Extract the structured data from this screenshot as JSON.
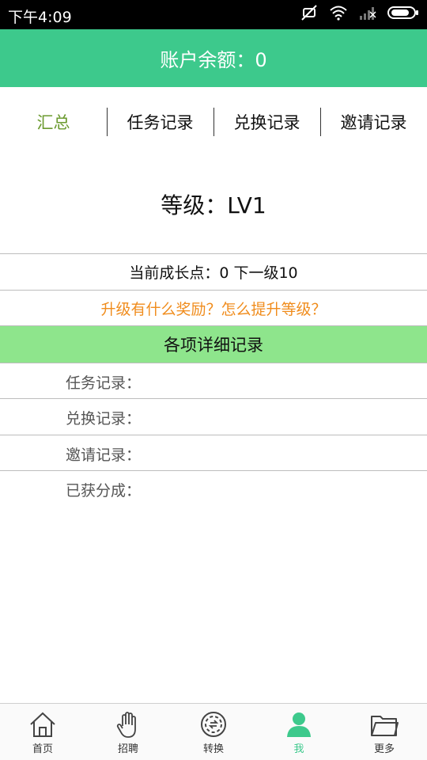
{
  "status_bar": {
    "time": "下午4:09"
  },
  "header": {
    "title": "账户余额：0"
  },
  "tabs": [
    {
      "label": "汇总",
      "active": true
    },
    {
      "label": "任务记录",
      "active": false
    },
    {
      "label": "兑换记录",
      "active": false
    },
    {
      "label": "邀请记录",
      "active": false
    }
  ],
  "summary": {
    "level_text": "等级：LV1",
    "growth_text": "当前成长点：0  下一级10",
    "reward_link": "升级有什么奖励？怎么提升等级？",
    "section_title": "各项详细记录",
    "details": [
      {
        "label": "任务记录："
      },
      {
        "label": "兑换记录："
      },
      {
        "label": "邀请记录："
      },
      {
        "label": "已获分成："
      }
    ]
  },
  "bottom_nav": [
    {
      "label": "首页",
      "icon": "home-icon"
    },
    {
      "label": "招聘",
      "icon": "hand-icon"
    },
    {
      "label": "转换",
      "icon": "exchange-icon"
    },
    {
      "label": "我",
      "icon": "user-icon",
      "active": true
    },
    {
      "label": "更多",
      "icon": "folder-icon"
    }
  ],
  "colors": {
    "accent": "#3dc98c",
    "section_bg": "#8ee58c",
    "active_tab": "#6b9a2f",
    "link": "#f08c1c"
  }
}
